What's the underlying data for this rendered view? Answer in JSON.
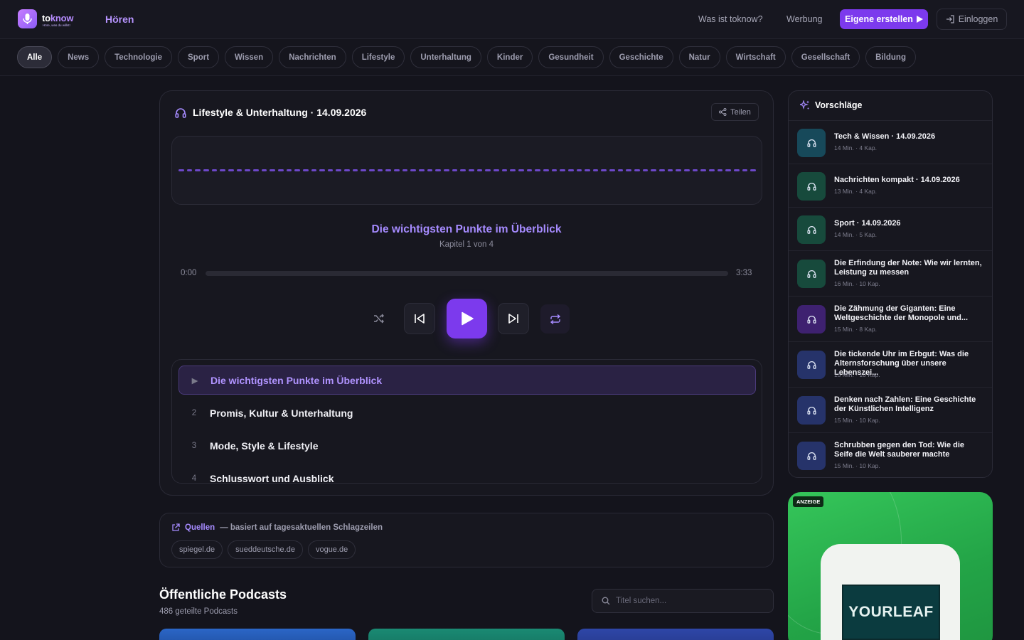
{
  "brand": {
    "name_a": "to",
    "name_b": "know",
    "tagline": "Höre, was du willst!"
  },
  "nav": {
    "hoeren": "Hören",
    "was_ist": "Was ist toknow?",
    "werbung": "Werbung",
    "create": "Eigene erstellen",
    "login": "Einloggen"
  },
  "categories": [
    "Alle",
    "News",
    "Technologie",
    "Sport",
    "Wissen",
    "Nachrichten",
    "Lifestyle",
    "Unterhaltung",
    "Kinder",
    "Gesundheit",
    "Geschichte",
    "Natur",
    "Wirtschaft",
    "Gesellschaft",
    "Bildung"
  ],
  "active_category": "Alle",
  "player": {
    "title": "Lifestyle & Unterhaltung · 14.09.2026",
    "share": "Teilen",
    "current_chapter": "Die wichtigsten Punkte im Überblick",
    "chapter_count": "Kapitel 1 von 4",
    "time_current": "0:00",
    "time_total": "3:33",
    "progress": 0,
    "chapters": [
      {
        "num": "▶",
        "label": "Die wichtigsten Punkte im Überblick"
      },
      {
        "num": "2",
        "label": "Promis, Kultur & Unterhaltung"
      },
      {
        "num": "3",
        "label": "Mode, Style & Lifestyle"
      },
      {
        "num": "4",
        "label": "Schlusswort und Ausblick"
      }
    ]
  },
  "sources": {
    "label": "Quellen",
    "sub": "— basiert auf tagesaktuellen Schlagzeilen",
    "items": [
      "spiegel.de",
      "sueddeutsche.de",
      "vogue.de"
    ]
  },
  "public": {
    "title": "Öffentliche Podcasts",
    "count": "486 geteilte Podcasts",
    "search_placeholder": "Titel suchen..."
  },
  "suggestions": {
    "title": "Vorschläge",
    "items": [
      {
        "title": "Tech & Wissen · 14.09.2026",
        "meta": "14 Min. · 4 Kap.",
        "color": "#17495a"
      },
      {
        "title": "Nachrichten kompakt · 14.09.2026",
        "meta": "13 Min. · 4 Kap.",
        "color": "#174a3c"
      },
      {
        "title": "Sport · 14.09.2026",
        "meta": "14 Min. · 5 Kap.",
        "color": "#174a3c"
      },
      {
        "title": "Die Erfindung der Note: Wie wir lernten, Leistung zu messen",
        "meta": "16 Min. · 10 Kap.",
        "color": "#174a3c"
      },
      {
        "title": "Die Zähmung der Giganten: Eine Weltgeschichte der Monopole und...",
        "meta": "15 Min. · 8 Kap.",
        "color": "#3e2170"
      },
      {
        "title": "Die tickende Uhr im Erbgut: Was die Alternsforschung über unsere Lebenszei...",
        "meta": "15 Min. · 10 Kap.",
        "color": "#26336a"
      },
      {
        "title": "Denken nach Zahlen: Eine Geschichte der Künstlichen Intelligenz",
        "meta": "15 Min. · 10 Kap.",
        "color": "#26336a"
      },
      {
        "title": "Schrubben gegen den Tod: Wie die Seife die Welt sauberer machte",
        "meta": "15 Min. · 10 Kap.",
        "color": "#26336a"
      }
    ]
  },
  "ad": {
    "badge": "ANZEIGE",
    "logo": "YOURLEAF"
  },
  "colors": {
    "accent": "#7c3aed",
    "accent_text": "#a68bff",
    "background": "#14141c"
  }
}
